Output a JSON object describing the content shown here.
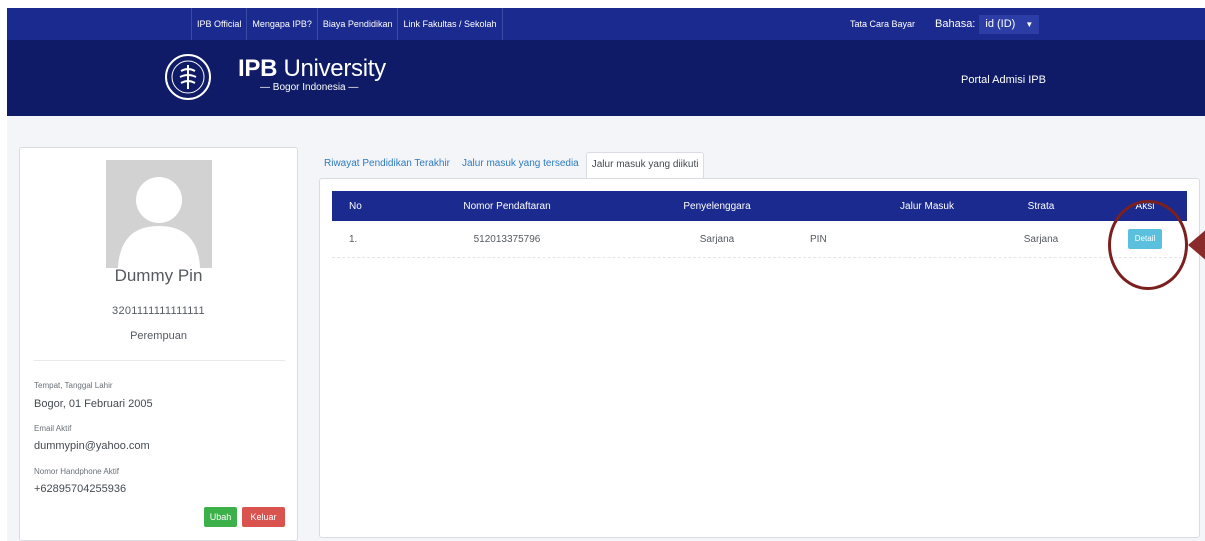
{
  "topbar": {
    "nav": [
      "IPB Official",
      "Mengapa IPB?",
      "Biaya Pendidikan",
      "Link Fakultas / Sekolah"
    ],
    "tata_cara": "Tata Cara Bayar",
    "bahasa_label": "Bahasa:",
    "bahasa_value": "id (ID)"
  },
  "header": {
    "brand_bold": "IPB",
    "brand_rest": " University",
    "brand_sub": "— Bogor Indonesia —",
    "portal": "Portal Admisi IPB"
  },
  "profile": {
    "name": "Dummy Pin",
    "number": "3201111111111111",
    "gender": "Perempuan",
    "ttl_label": "Tempat, Tanggal Lahir",
    "ttl_value": "Bogor, 01 Februari 2005",
    "email_label": "Email Aktif",
    "email_value": "dummypin@yahoo.com",
    "phone_label": "Nomor Handphone Aktif",
    "phone_value": "+62895704255936",
    "btn_ubah": "Ubah",
    "btn_keluar": "Keluar"
  },
  "tabs": [
    "Riwayat Pendidikan Terakhir",
    "Jalur masuk yang tersedia",
    "Jalur masuk yang diikuti"
  ],
  "table": {
    "headers": {
      "no": "No",
      "nomor": "Nomor Pendaftaran",
      "penyelenggara": "Penyelenggara",
      "jalur": "Jalur Masuk",
      "strata": "Strata",
      "aksi": "Aksi"
    },
    "rows": [
      {
        "no": "1.",
        "nomor": "512013375796",
        "penyelenggara": "Sarjana",
        "jalur": "PIN",
        "strata": "Sarjana",
        "action": "Detail"
      }
    ]
  },
  "colors": {
    "topbar": "#1b2a8f",
    "header": "#0f1b66",
    "table_header": "#1b2a8f",
    "btn_ubah": "#3cb14a",
    "btn_keluar": "#d9534f",
    "btn_detail": "#5bc0de",
    "annotation": "#7b1f1f"
  },
  "icons": {
    "logo": "ipb-seal-icon",
    "avatar": "user-avatar-icon",
    "dropdown": "caret-down-icon",
    "annotation": "highlight-circle-arrow"
  }
}
